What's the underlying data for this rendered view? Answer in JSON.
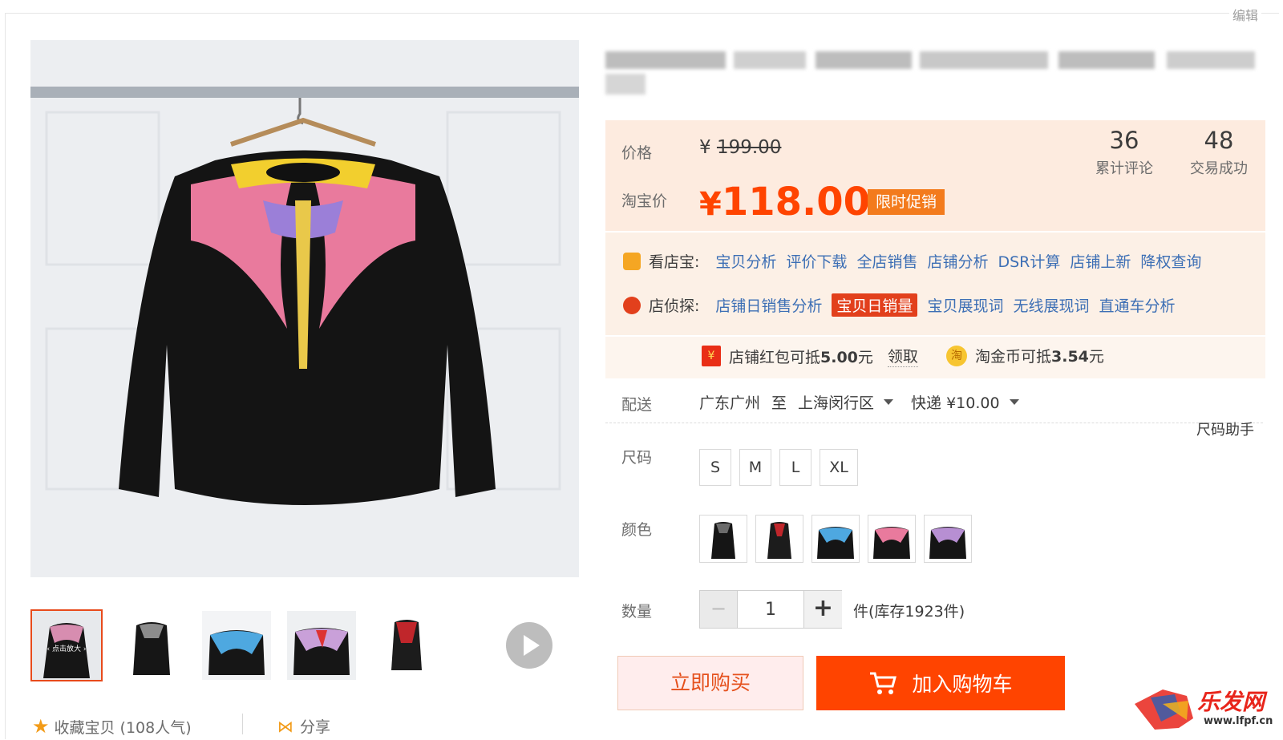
{
  "header": {
    "edit_label": "编辑"
  },
  "gallery": {
    "main_image_icon": "sweatshirt-wing-print-icon",
    "thumb_overlay_text": "点击放大",
    "thumbnails_count": 6,
    "active_thumbnail": 1
  },
  "actions": {
    "favorite_label": "收藏宝贝 (108人气)",
    "share_label": "分享"
  },
  "price": {
    "price_label": "价格",
    "old_price_symbol": "¥",
    "old_price": "199.00",
    "taobao_label": "淘宝价",
    "new_price_symbol": "¥",
    "new_price": "118.00",
    "promo_tag": "限时促销"
  },
  "stats": [
    {
      "number": "36",
      "label": "累计评论"
    },
    {
      "number": "48",
      "label": "交易成功"
    }
  ],
  "plugins": {
    "kandianbao": {
      "name": "看店宝:",
      "links": [
        "宝贝分析",
        "评价下载",
        "全店销售",
        "店铺分析",
        "DSR计算",
        "店铺上新",
        "降权查询"
      ]
    },
    "dianzhentan": {
      "name": "店侦探:",
      "links": [
        "店铺日销售分析",
        "宝贝日销量",
        "宝贝展现词",
        "无线展现词",
        "直通车分析"
      ]
    }
  },
  "coupon": {
    "red_pack_prefix": "店铺红包可抵",
    "red_pack_amount": "5.00",
    "red_pack_unit": "元",
    "get_label": "领取",
    "coin_prefix": "淘金币可抵",
    "coin_amount": "3.54",
    "coin_unit": "元",
    "red_pack_icon_text": "¥",
    "coin_icon_text": "淘"
  },
  "shipping": {
    "label": "配送",
    "from": "广东广州",
    "to_word": "至",
    "to": "上海闵行区",
    "method": "快递 ¥10.00"
  },
  "size": {
    "label": "尺码",
    "helper": "尺码助手",
    "options": [
      "S",
      "M",
      "L",
      "XL"
    ]
  },
  "color": {
    "label": "颜色",
    "options_count": 5
  },
  "quantity": {
    "label": "数量",
    "minus": "−",
    "value": "1",
    "plus": "+",
    "stock": "件(库存1923件)"
  },
  "buttons": {
    "buy_now": "立即购买",
    "add_cart": "加入购物车"
  },
  "watermark": {
    "text": "乐发网",
    "url": "www.lfpf.cn"
  },
  "colors": {
    "accent": "#ff4400",
    "promo": "#f37b1d",
    "link": "#3d6fb5",
    "panel": "#fdebdf"
  }
}
